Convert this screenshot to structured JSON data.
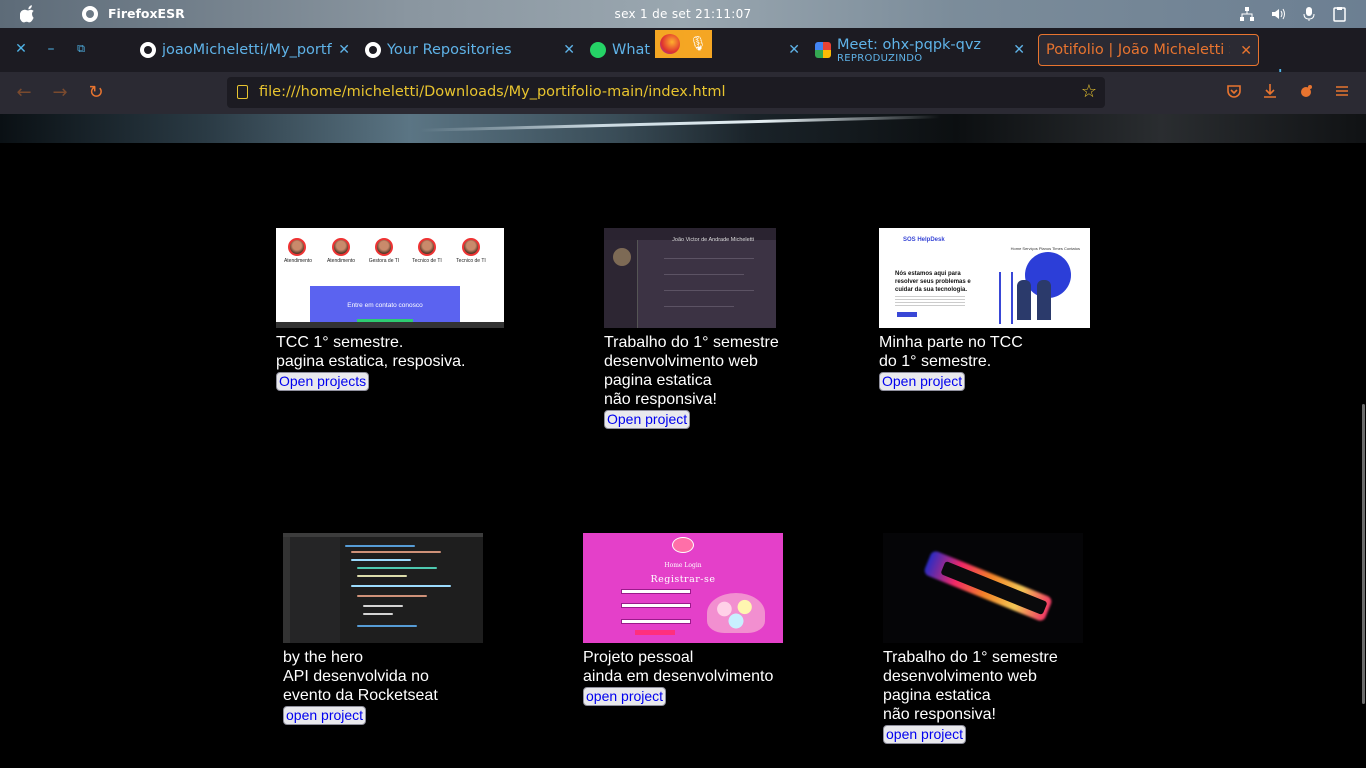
{
  "system_bar": {
    "app_name": "FirefoxESR",
    "clock": "sex 1 de set  21:11:07"
  },
  "tabs": [
    {
      "title": "joaoMicheletti/My_portfo",
      "icon": "github-icon"
    },
    {
      "title": "Your Repositories",
      "icon": "github-icon"
    },
    {
      "title": "WhatsApp",
      "icon": "whatsapp-icon"
    },
    {
      "title": "Meet: ohx-pqpk-qvz",
      "subtitle": "REPRODUZINDO",
      "icon": "google-meet-icon"
    },
    {
      "title": "Potifolio | João Micheletti So",
      "icon": "none",
      "active": true
    }
  ],
  "tab_truncated_whatsapp": "What",
  "navigation": {
    "url": "file:///home/micheletti/Downloads/My_portifolio-main/index.html"
  },
  "thumbs": {
    "tcc_people": [
      "Atendimento",
      "Atendimento",
      "Gestora de TI",
      "Tecnico de TI",
      "Tecnico de TI"
    ],
    "tcc_banner": "Entre em contato conosco",
    "cv_header": "João Victor de Andrade Micheletti",
    "helpdesk_logo": "SOS HelpDesk",
    "helpdesk_menu": "Home  Serviços  Planos  Times  Contatos",
    "helpdesk_headline": "Nós estamos aqui para resolver seus problemas e cuidar da sua tecnologia.",
    "login_nav": "Home  Login",
    "login_title": "Registrar-se"
  },
  "projects": [
    {
      "desc": "TCC 1° semestre.\npagina estatica, resposiva.",
      "button": "Open projects"
    },
    {
      "desc": "Trabalho do 1° semestre\ndesenvolvimento web\npagina estatica\nnão responsiva!",
      "button": "Open project"
    },
    {
      "desc": "Minha parte no TCC\ndo 1° semestre.",
      "button": "Open project"
    },
    {
      "desc": "by the hero\nAPI desenvolvida no\nevento da Rocketseat",
      "button": "open project"
    },
    {
      "desc": "Projeto pessoal\nainda em desenvolvimento",
      "button": "open project"
    },
    {
      "desc": "Trabalho do 1° semestre\ndesenvolvimento web\npagina estatica\nnão responsiva!",
      "button": "open project"
    }
  ]
}
